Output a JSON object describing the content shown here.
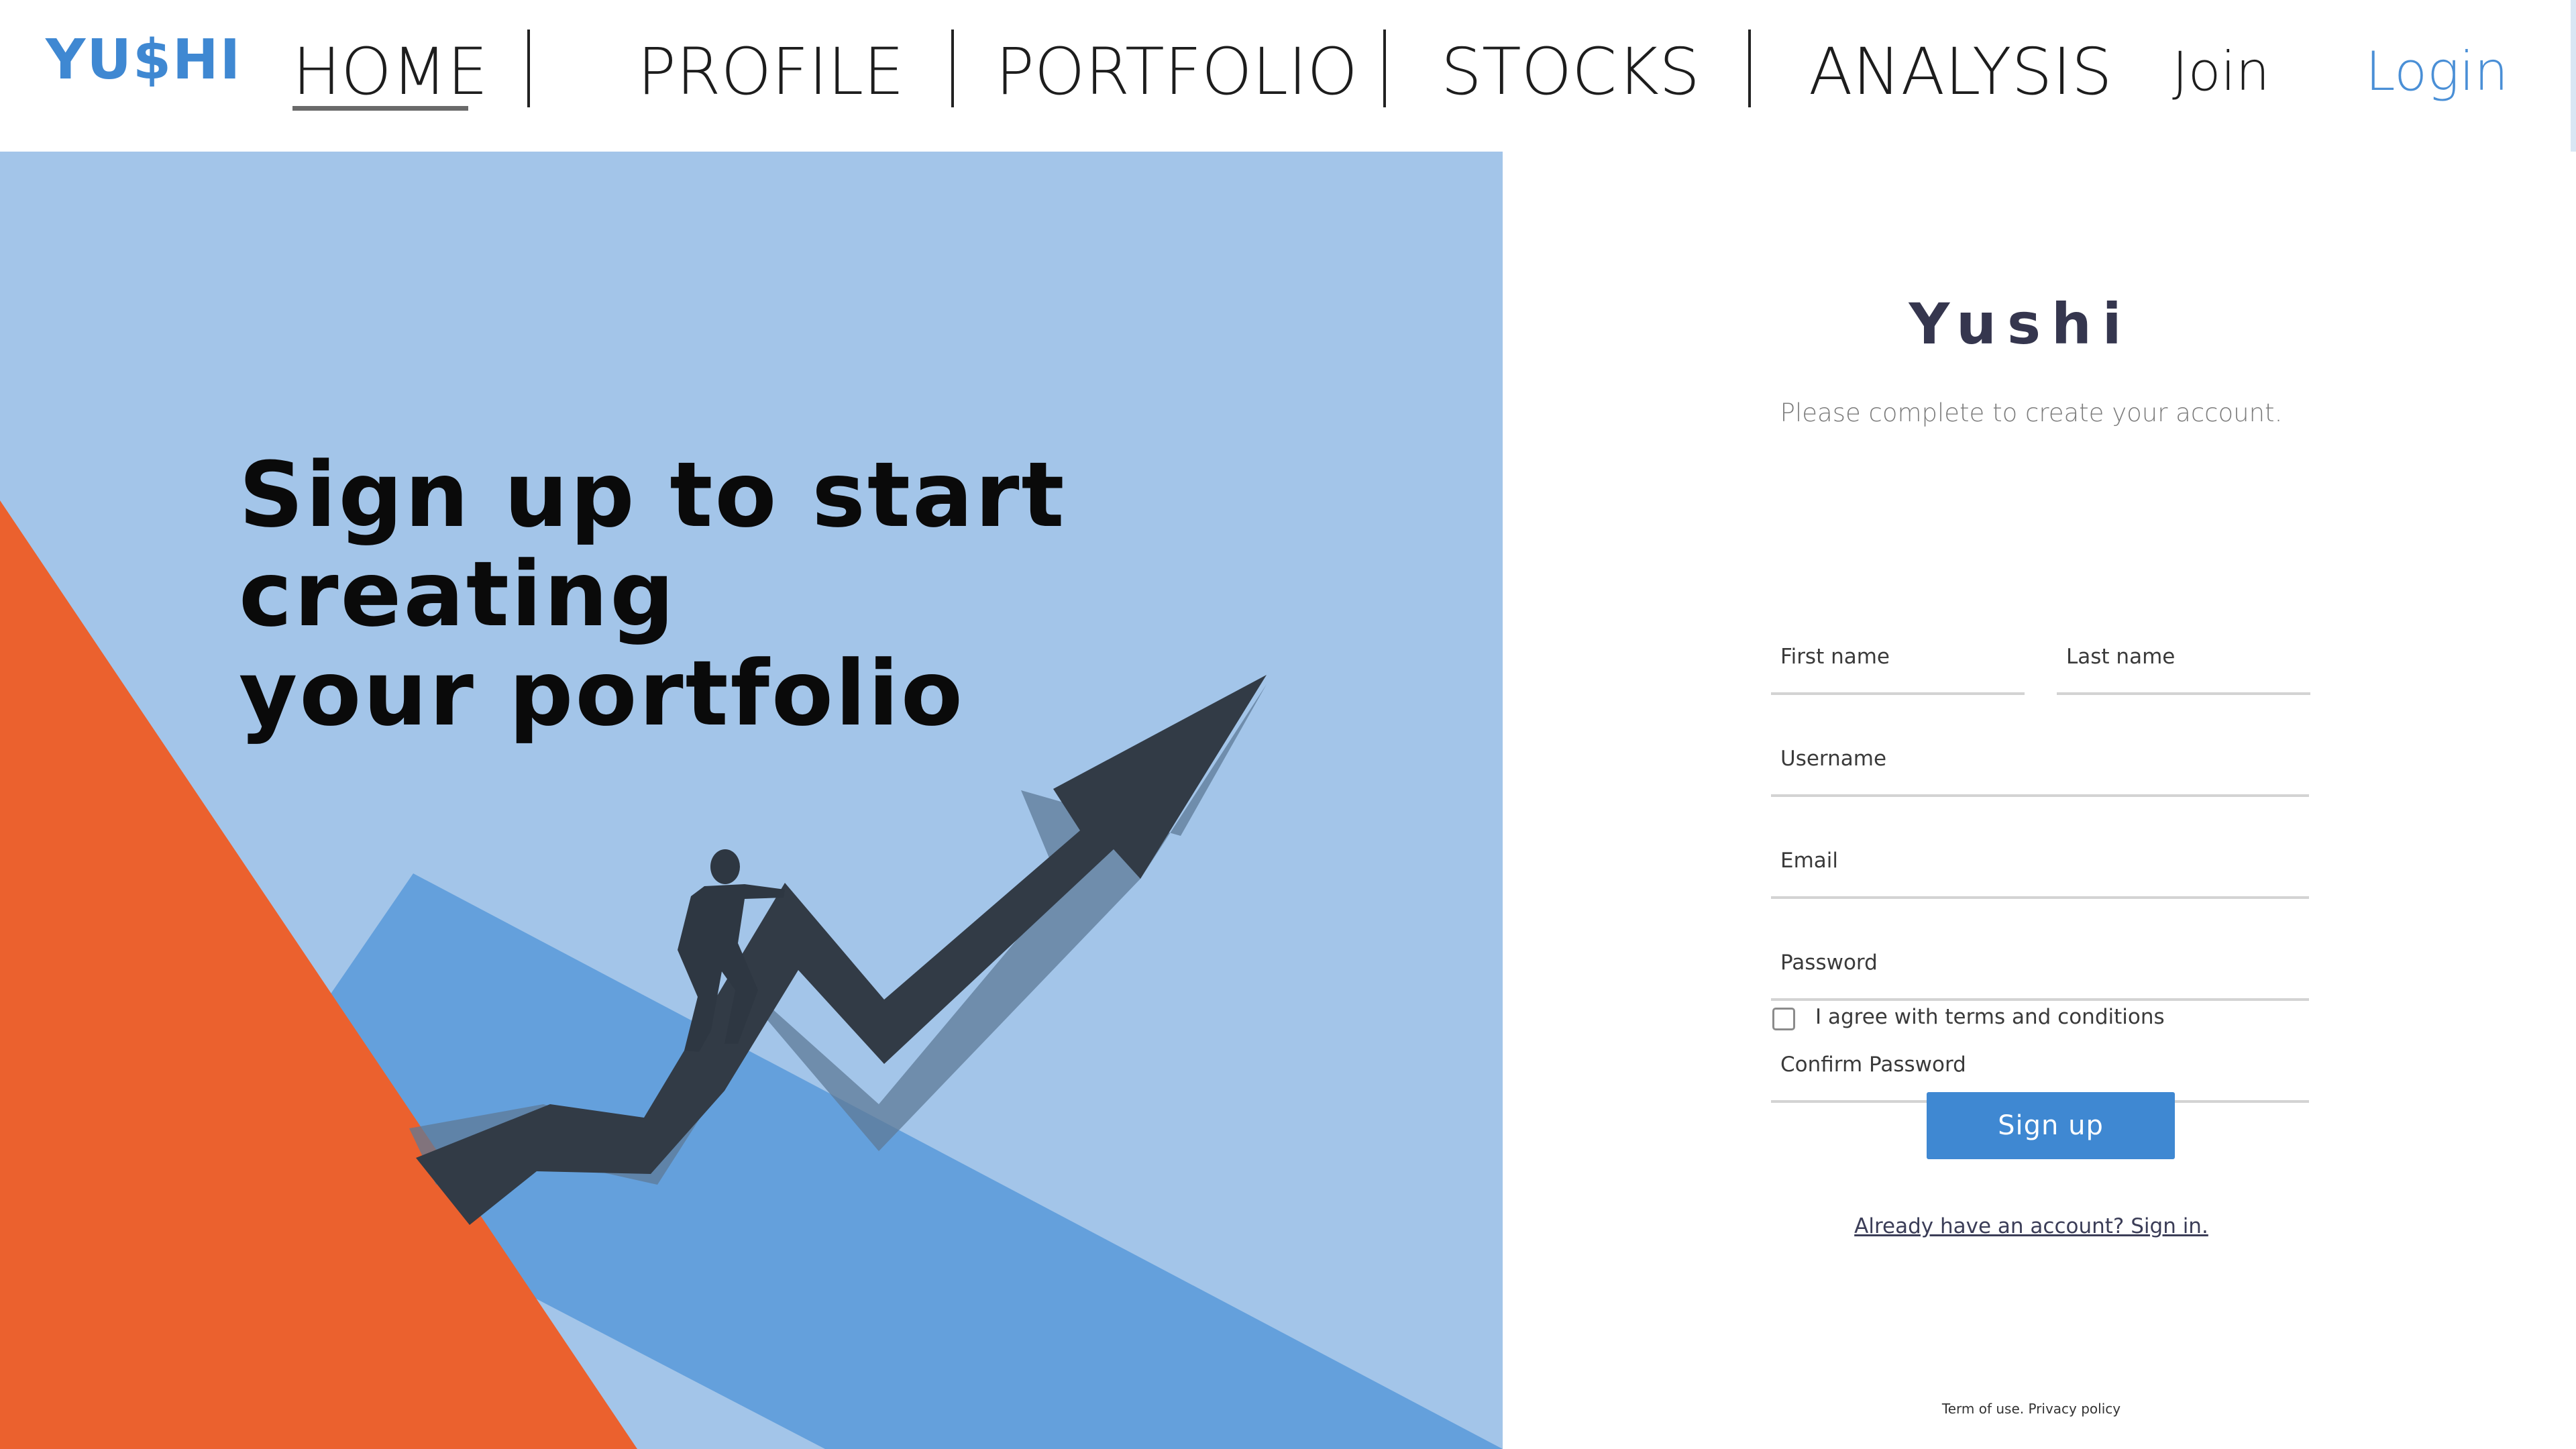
{
  "nav": {
    "logo": "YU$HI",
    "links": [
      "HOME",
      "PROFILE",
      "PORTFOLIO",
      "STOCKS",
      "ANALYSIS"
    ],
    "active": "HOME",
    "join": "Join",
    "login": "Login"
  },
  "hero": {
    "title_line1": "Sign up to start creating",
    "title_line2": "your portfolio"
  },
  "form": {
    "brand": "Yushi",
    "subtitle": "Please complete to create your account.",
    "first_name_placeholder": "First name",
    "last_name_placeholder": "Last name",
    "username_placeholder": "Username",
    "email_placeholder": "Email",
    "password_placeholder": "Password",
    "confirm_password_placeholder": "Confirm Password",
    "terms_label": "I agree with terms and conditions",
    "terms_checked": false,
    "signup_label": "Sign up",
    "signin_link": "Already have an account? Sign in.",
    "footer": "Term of use. Privacy policy"
  },
  "colors": {
    "accent": "#3f88d2",
    "hero_bg": "#a3c5e9",
    "orange": "#eb612e",
    "mid_blue": "#64a0dc",
    "arrow": "#323b46"
  },
  "icons": {
    "logo": "yushi-logo",
    "hero_art": "businessman-climbing-arrow-illustration"
  }
}
